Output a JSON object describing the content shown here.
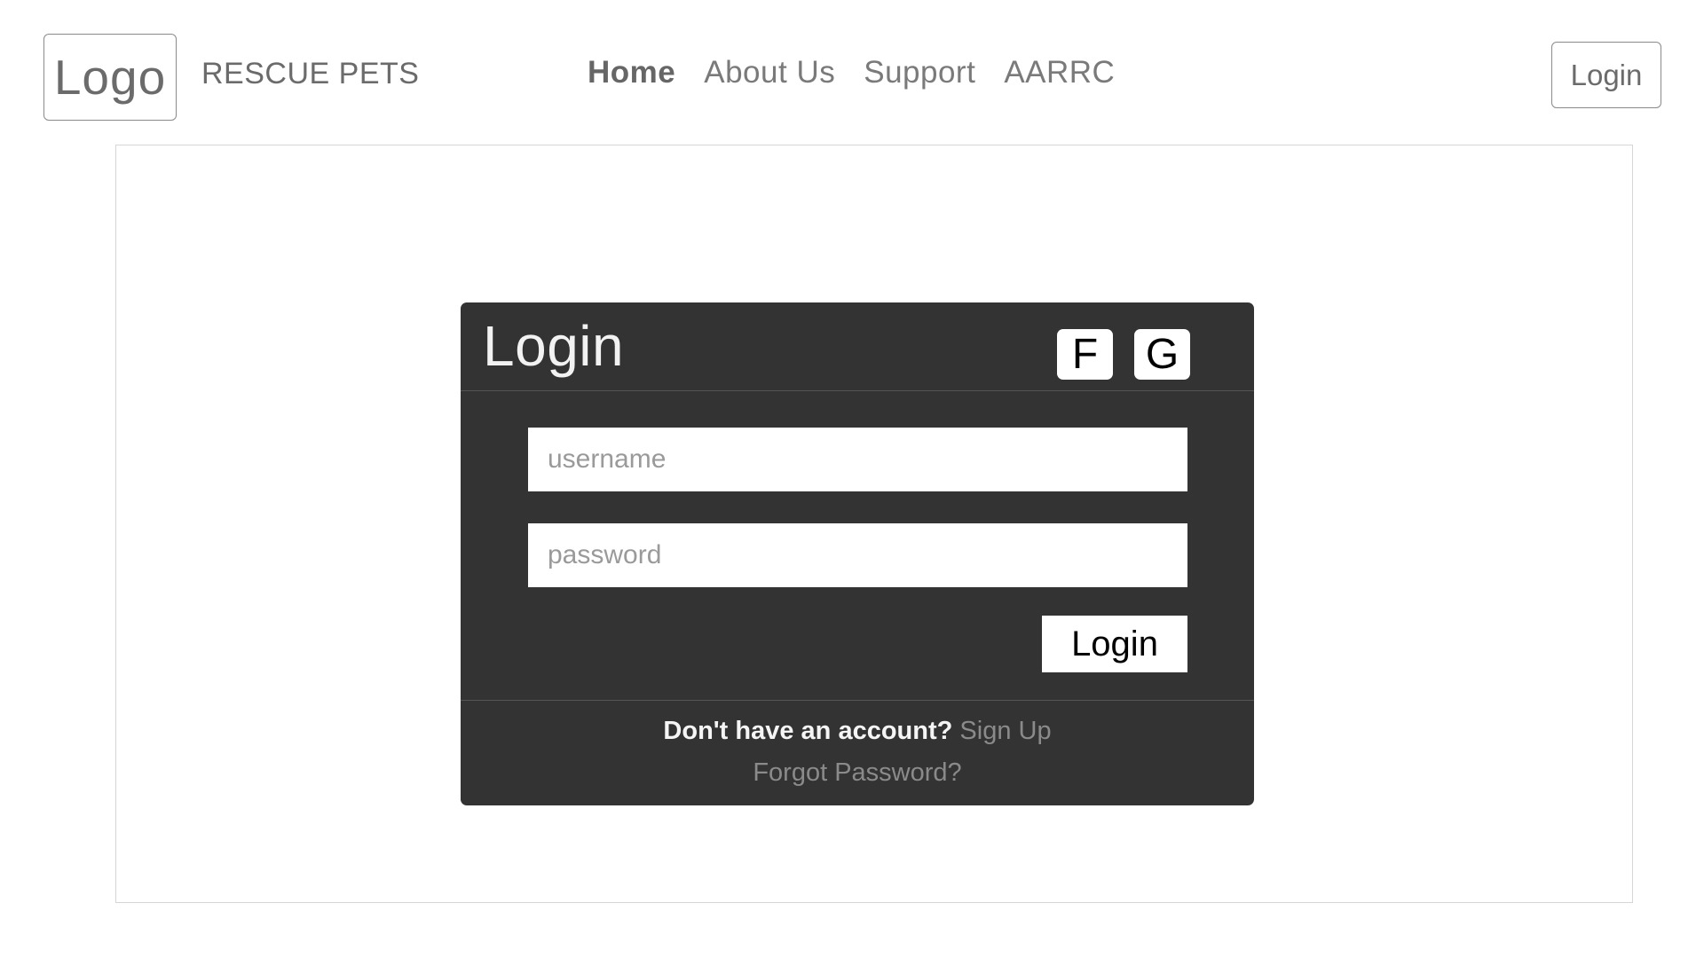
{
  "header": {
    "logo": "Logo",
    "brand": "RESCUE PETS",
    "nav": [
      {
        "label": "Home",
        "active": true
      },
      {
        "label": "About Us",
        "active": false
      },
      {
        "label": "Support",
        "active": false
      },
      {
        "label": "AARRC",
        "active": false
      }
    ],
    "login_label": "Login"
  },
  "login_card": {
    "title": "Login",
    "social": {
      "facebook_label": "F",
      "google_label": "G"
    },
    "username": {
      "value": "",
      "placeholder": "username"
    },
    "password": {
      "value": "",
      "placeholder": "password"
    },
    "submit_label": "Login",
    "footer": {
      "no_account_text": "Don't have an account?",
      "signup_label": "Sign Up",
      "forgot_label": "Forgot Password?"
    }
  },
  "colors": {
    "card_background": "#333333",
    "link_gray": "#8a8a8a",
    "text_gray": "#6b6b6b"
  }
}
